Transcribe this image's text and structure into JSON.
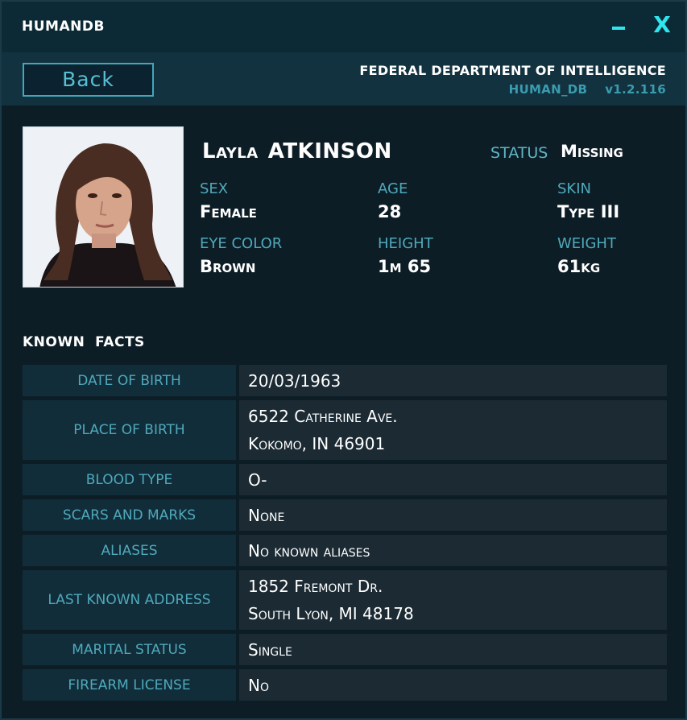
{
  "window": {
    "title": "HUMANDB",
    "minimize_label": "−",
    "close_label": "X"
  },
  "header": {
    "back_label": "Back",
    "agency": "FEDERAL DEPARTMENT OF INTELLIGENCE",
    "db_name": "HUMAN_DB",
    "version": "v1.2.116"
  },
  "profile": {
    "first_name": "Layla",
    "last_name": "ATKINSON",
    "status_label": "STATUS",
    "status_value": "Missing",
    "attributes": [
      {
        "label": "SEX",
        "value": "Female"
      },
      {
        "label": "AGE",
        "value": "28"
      },
      {
        "label": "SKIN",
        "value": "Type III"
      },
      {
        "label": "EYE COLOR",
        "value": "Brown"
      },
      {
        "label": "HEIGHT",
        "value": "1m 65"
      },
      {
        "label": "WEIGHT",
        "value": "61kg"
      }
    ]
  },
  "facts": {
    "title": "KNOWN  FACTS",
    "rows": [
      {
        "label": "DATE OF BIRTH",
        "lines": [
          "20/03/1963"
        ]
      },
      {
        "label": "PLACE OF BIRTH",
        "lines": [
          "6522 Catherine Ave.",
          "Kokomo, IN 46901"
        ]
      },
      {
        "label": "BLOOD TYPE",
        "lines": [
          "O-"
        ]
      },
      {
        "label": "SCARS AND MARKS",
        "lines": [
          "None"
        ]
      },
      {
        "label": "ALIASES",
        "lines": [
          "No known aliases"
        ]
      },
      {
        "label": "LAST KNOWN ADDRESS",
        "lines": [
          "1852 Fremont Dr.",
          "South Lyon, MI 48178"
        ]
      },
      {
        "label": "MARITAL STATUS",
        "lines": [
          "Single"
        ]
      },
      {
        "label": "FIREARM LICENSE",
        "lines": [
          "No"
        ]
      }
    ]
  },
  "colors": {
    "accent": "#2fe6ef",
    "label": "#4fa9bb",
    "panel": "#112d3a",
    "value_bg": "#1b2a33"
  }
}
